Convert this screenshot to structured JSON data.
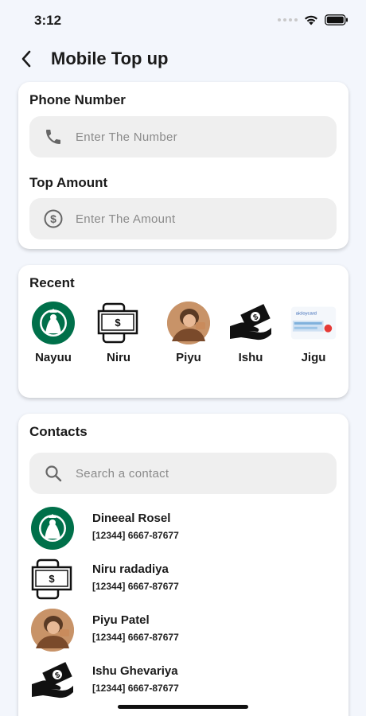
{
  "status_bar": {
    "time": "3:12"
  },
  "header": {
    "title": "Mobile Top up",
    "back_icon": "chevron-left-icon"
  },
  "phone_card": {
    "phone_label": "Phone Number",
    "phone_placeholder": "Enter The Number",
    "phone_icon": "phone-icon",
    "amount_label": "Top Amount",
    "amount_placeholder": "Enter The Amount",
    "amount_icon": "dollar-circle-icon"
  },
  "recent": {
    "title": "Recent",
    "items": [
      {
        "name": "Nayuu",
        "avatar": "starbucks-logo"
      },
      {
        "name": "Niru",
        "avatar": "money-phone-icon"
      },
      {
        "name": "Piyu",
        "avatar": "person-photo"
      },
      {
        "name": "Ishu",
        "avatar": "hand-money-icon"
      },
      {
        "name": "Jigu",
        "avatar": "card-image"
      }
    ]
  },
  "contacts": {
    "title": "Contacts",
    "search_placeholder": "Search a contact",
    "search_icon": "search-icon",
    "items": [
      {
        "name": "Dineeal Rosel",
        "phone": "[12344] 6667-87677",
        "avatar": "starbucks-logo"
      },
      {
        "name": "Niru radadiya",
        "phone": "[12344] 6667-87677",
        "avatar": "money-phone-icon"
      },
      {
        "name": "Piyu Patel",
        "phone": "[12344] 6667-87677",
        "avatar": "person-photo"
      },
      {
        "name": "Ishu Ghevariya",
        "phone": "[12344] 6667-87677",
        "avatar": "hand-money-icon"
      }
    ]
  },
  "colors": {
    "background": "#f3f6fc",
    "card": "#ffffff",
    "field": "#efefef",
    "starbucks_green": "#00704a"
  }
}
